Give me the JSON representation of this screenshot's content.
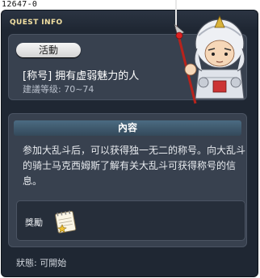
{
  "quest": {
    "id_text": "12647-0",
    "window_title": "QUEST INFO",
    "badge": "活動",
    "name": "[称号] 拥有虚弱魅力的人",
    "recommended_level": "建議等级: 70~74",
    "content_header": "內容",
    "description": "参加大乱斗后，可以获得独一无二的称号。向大乱斗的骑士马克西姆斯了解有关大乱斗可获得称号的信息。",
    "reward_label": "獎勵",
    "reward_icon": "note-pad-icon",
    "status": "狀態: 可開始"
  },
  "colors": {
    "window_bg": "#1f2733",
    "panel_bg": "#38414f",
    "title_gold": "#f2e0a2",
    "header_teal": "#4b6b82"
  }
}
